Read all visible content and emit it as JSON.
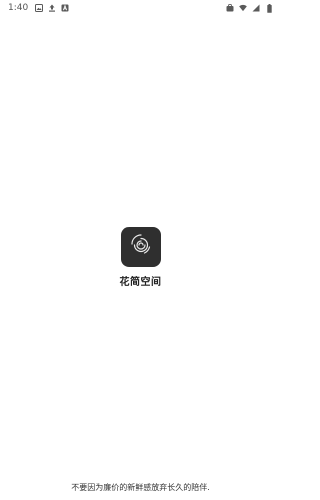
{
  "status_bar": {
    "time": "1:40",
    "left_icons": [
      "image-icon",
      "upload-icon",
      "a-box-icon"
    ],
    "right_icons": [
      "briefcase-icon",
      "wifi-icon",
      "cell-signal-icon",
      "battery-icon"
    ]
  },
  "splash": {
    "app_name": "花简空间",
    "icon_name": "swirl-logo-icon",
    "icon_bg": "#2f2f2f",
    "slogan": "不要因为廉价的新鲜感放弃长久的陪伴."
  }
}
